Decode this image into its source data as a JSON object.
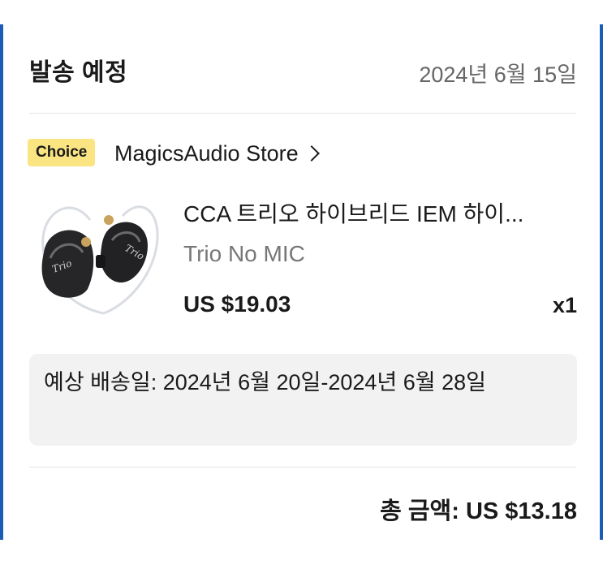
{
  "header": {
    "title": "발송 예정",
    "date": "2024년 6월 15일"
  },
  "store": {
    "badge": "Choice",
    "name": "MagicsAudio Store"
  },
  "product": {
    "title": "CCA 트리오 하이브리드 IEM 하이...",
    "variant": "Trio No MIC",
    "price": "US $19.03",
    "quantity": "x1",
    "image_icon": "earphones-image"
  },
  "delivery": {
    "text": "예상 배송일: 2024년 6월 20일-2024년 6월 28일"
  },
  "summary": {
    "total": "총 금액: US $13.18"
  },
  "colors": {
    "badge": "#fbe482",
    "edge": "#1b5db4",
    "delivery_bg": "#f2f2f2"
  }
}
